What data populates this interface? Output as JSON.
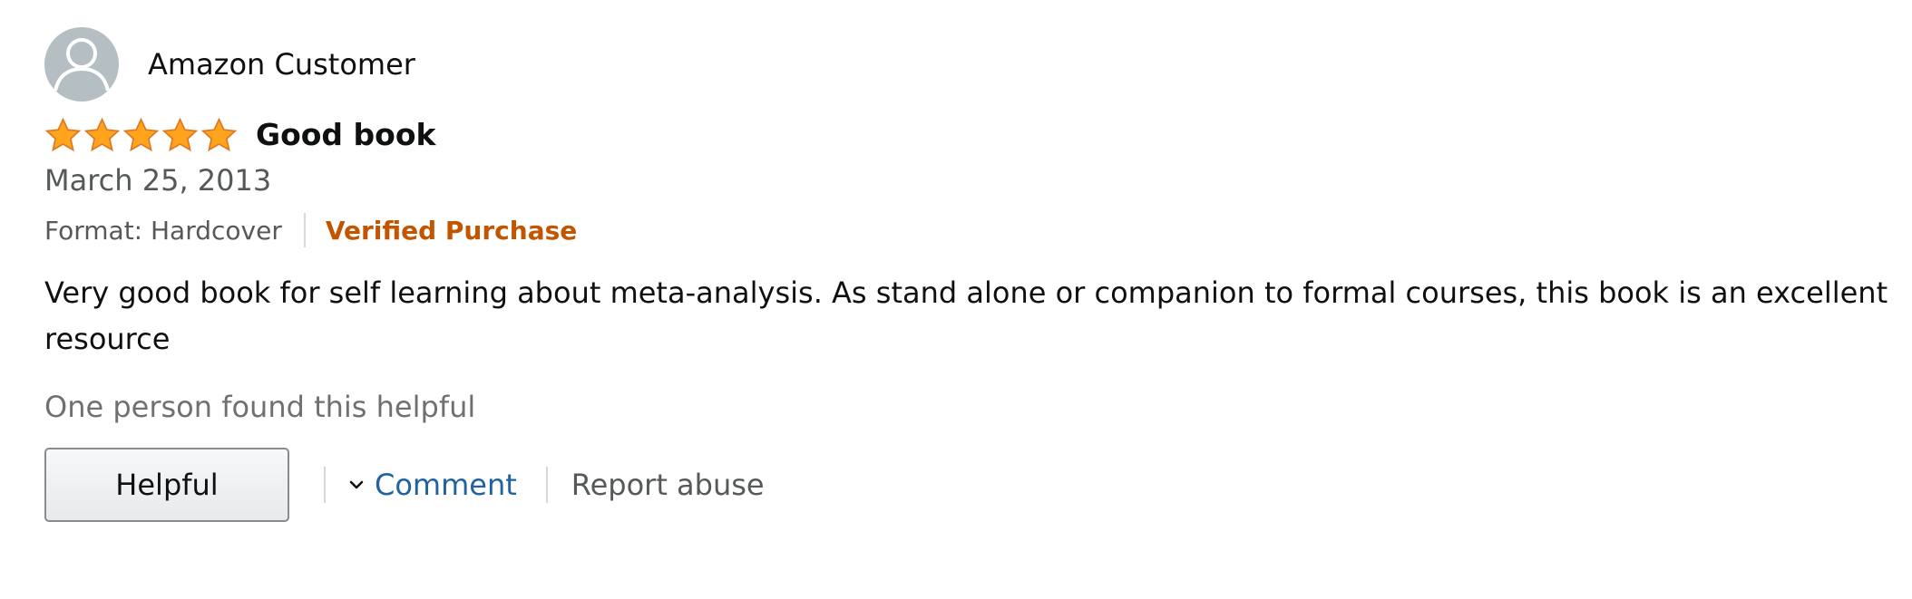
{
  "review": {
    "profile": {
      "name": "Amazon Customer",
      "avatar_icon": "default-user-avatar-icon",
      "avatar_color": "#b4bec3"
    },
    "rating": {
      "stars": 5,
      "max_stars": 5,
      "star_icon": "star-icon",
      "star_color": "#ffa41c"
    },
    "title": "Good book",
    "date": "March 25, 2013",
    "format": "Format: Hardcover",
    "verified_label": "Verified Purchase",
    "verified_color": "#c45500",
    "body": "Very good book for self learning about meta-analysis. As stand alone or companion to formal courses, this book is an excellent resource",
    "helpful_count_text": "One person found this helpful",
    "actions": {
      "helpful_label": "Helpful",
      "comment_label": "Comment",
      "comment_icon": "chevron-down-icon",
      "report_label": "Report abuse"
    },
    "link_color": "#2162a1"
  }
}
